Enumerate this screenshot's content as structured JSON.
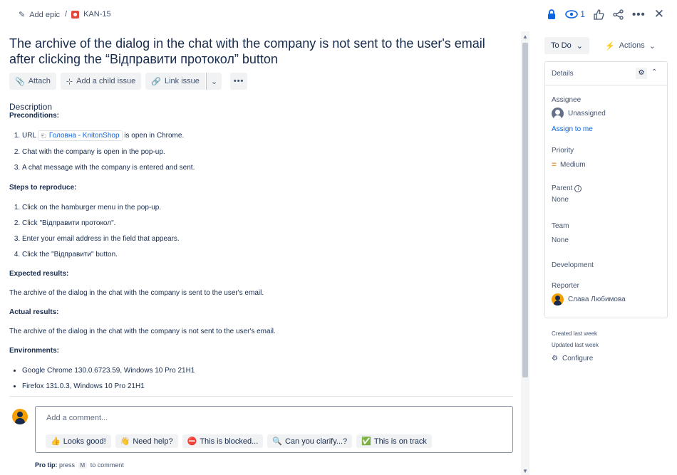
{
  "breadcrumb": {
    "epic_label": "Add epic",
    "separator": "/",
    "issue_key": "KAN-15"
  },
  "topbar": {
    "watch_count": "1"
  },
  "issue": {
    "title": "The archive of the dialog in the chat with the company is not sent to the user's email after clicking the “Відправити протокол” button"
  },
  "toolbar": {
    "attach": "Attach",
    "child_issue": "Add a child issue",
    "link_issue": "Link issue"
  },
  "description": {
    "heading": "Description",
    "preconditions_heading": "Preconditions:",
    "pre1_prefix": "URL",
    "pre1_link": "Головна - KnitonShop",
    "pre1_suffix": "is open in Chrome.",
    "pre2": "Chat with the company is open in the pop-up.",
    "pre3": "A chat message with the company is entered and sent.",
    "steps_heading": "Steps to reproduce:",
    "steps": [
      "Click on the hamburger menu in the pop-up.",
      "Click \"Відправити протокол\".",
      "Enter your email address in the field that appears.",
      "Click the \"Відправити\" button."
    ],
    "expected_heading": "Expected results:",
    "expected": "The archive of the dialog in the chat with the company is sent to the user's email.",
    "actual_heading": "Actual results:",
    "actual": "The archive of the dialog in the chat with the company is not sent to the user's email.",
    "env_heading": "Environments:",
    "envs": [
      "Google Chrome 130.0.6723.59, Windows 10 Pro 21H1",
      "Firefox 131.0.3, Windows 10 Pro 21H1"
    ]
  },
  "comment": {
    "placeholder": "Add a comment...",
    "chips": [
      {
        "emoji": "👍",
        "label": "Looks good!"
      },
      {
        "emoji": "👋",
        "label": "Need help?"
      },
      {
        "emoji": "⛔",
        "label": "This is blocked..."
      },
      {
        "emoji": "🔍",
        "label": "Can you clarify...?"
      },
      {
        "emoji": "✅",
        "label": "This is on track"
      }
    ],
    "protip_bold": "Pro tip:",
    "protip_pre": "press",
    "protip_key": "M",
    "protip_post": "to comment"
  },
  "sidebar": {
    "status": "To Do",
    "actions": "Actions",
    "details_title": "Details",
    "assignee_label": "Assignee",
    "assignee_value": "Unassigned",
    "assign_to_me": "Assign to me",
    "priority_label": "Priority",
    "priority_value": "Medium",
    "parent_label": "Parent",
    "parent_value": "None",
    "team_label": "Team",
    "team_value": "None",
    "development_label": "Development",
    "reporter_label": "Reporter",
    "reporter_value": "Слава Любимова",
    "created": "Created last week",
    "updated": "Updated last week",
    "configure": "Configure"
  },
  "colors": {
    "accent": "#0c66e4",
    "issue_type": "#e2483d",
    "priority_medium": "#e2a03f",
    "avatar": "#f59f00"
  }
}
